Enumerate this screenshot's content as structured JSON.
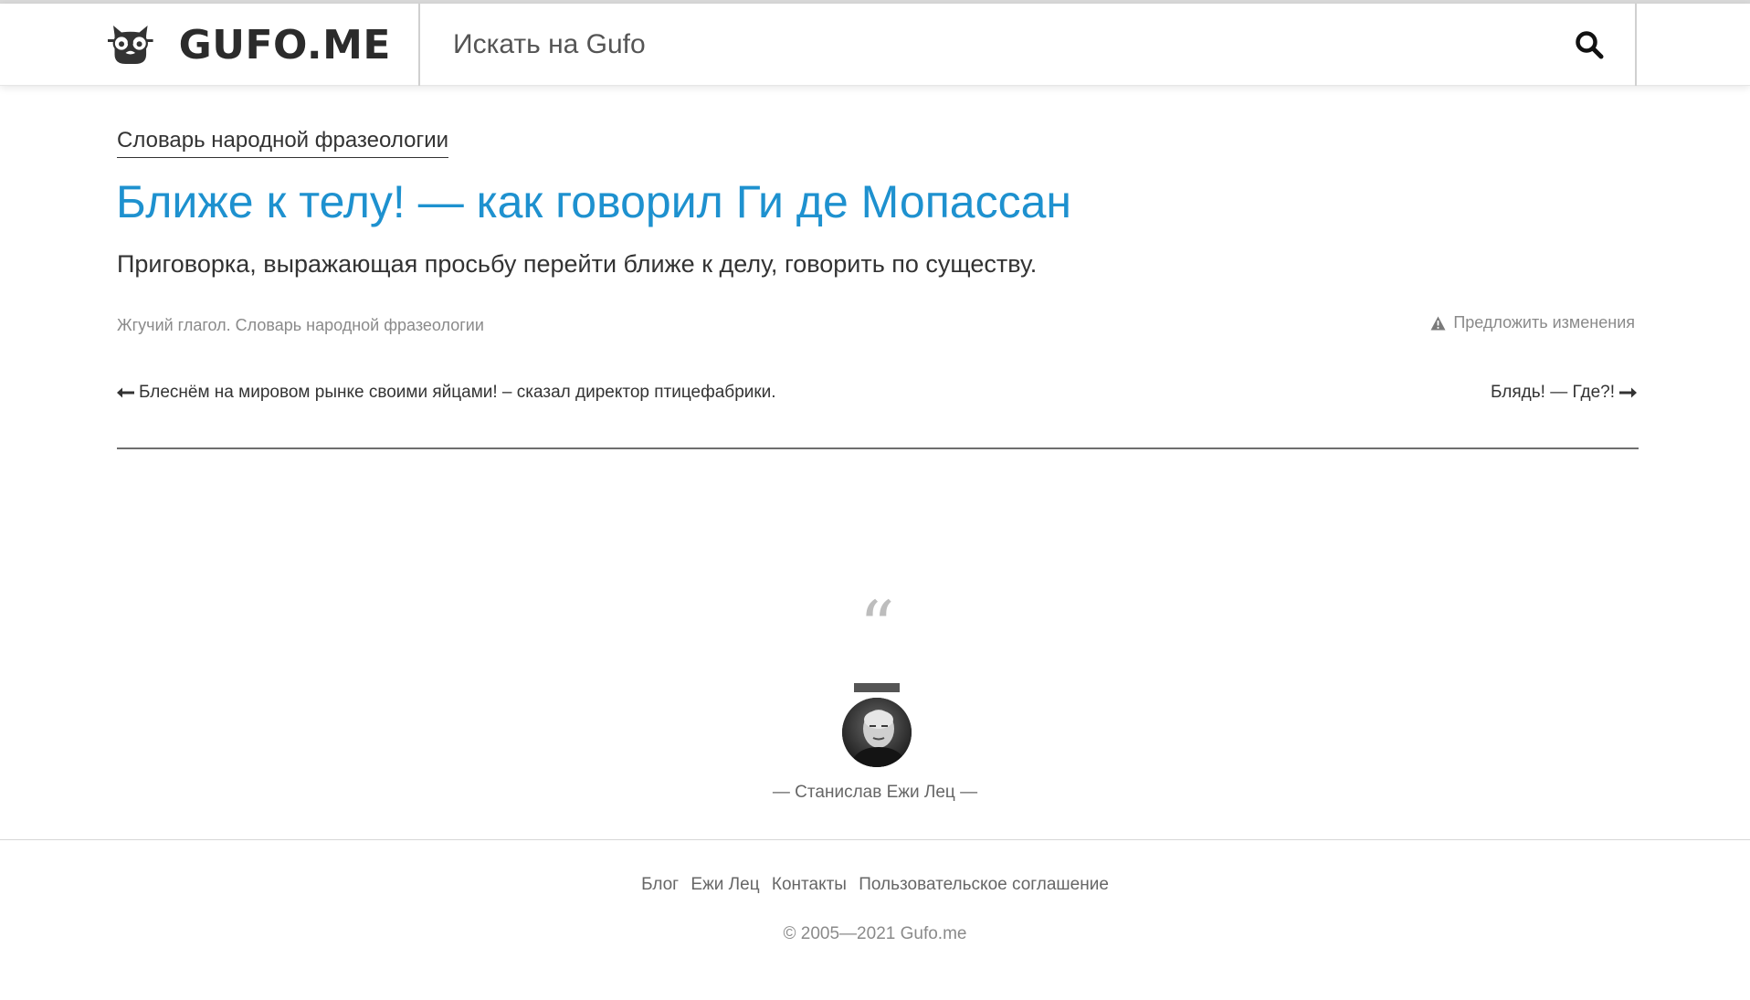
{
  "header": {
    "logo_text": "GUFO.ME",
    "search_placeholder": "Искать на Gufo",
    "search_icon": "search-icon"
  },
  "article": {
    "dictionary_link": "Словарь народной фразеологии",
    "title": "Ближе к телу! — как говорил Ги де Мопассан",
    "definition": "Приговорка, выражающая просьбу перейти ближе к делу, говорить по существу.",
    "source": "Жгучий глагол. Словарь народной фразеологии",
    "suggest_changes": "Предложить изменения",
    "suggest_icon": "warning-icon"
  },
  "navigation": {
    "prev_label": "Блеснём на мировом рынке своими яйцами! – сказал директор птицефабрики.",
    "next_label": "Блядь! — Где?!"
  },
  "quote": {
    "mark": "“",
    "author": "— Станислав Ежи Лец —"
  },
  "footer": {
    "links": [
      "Блог",
      "Ежи Лец",
      "Контакты",
      "Пользовательское соглашение"
    ],
    "copyright": "© 2005—2021 Gufo.me"
  },
  "colors": {
    "title": "#1e91cf",
    "text": "#333333",
    "muted": "#8a8a8a"
  }
}
